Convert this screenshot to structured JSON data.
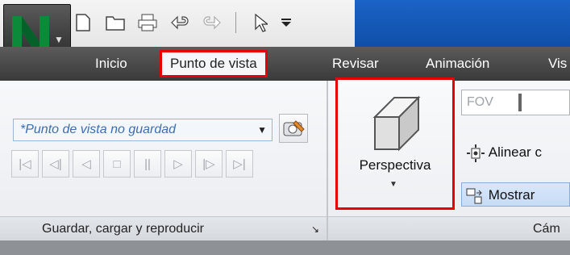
{
  "app": {
    "logo_icon": "navisworks-n-logo",
    "logo_color": "#0b8a3a"
  },
  "quick_access": [
    {
      "icon": "new-file-icon"
    },
    {
      "icon": "open-folder-icon"
    },
    {
      "icon": "print-icon"
    },
    {
      "icon": "undo-icon"
    },
    {
      "icon": "redo-icon"
    },
    {
      "icon": "select-cursor-icon"
    },
    {
      "icon": "customize-dropdown-icon"
    }
  ],
  "tabs": [
    {
      "label": "Inicio"
    },
    {
      "label": "Punto de vista",
      "active": true
    },
    {
      "label": "Revisar"
    },
    {
      "label": "Animación"
    },
    {
      "label": "Vis"
    }
  ],
  "saveload": {
    "viewpoint_value": "*Punto de vista no guardad",
    "panel_label": "Guardar, cargar y reproducir",
    "playback": [
      "first-frame-icon",
      "step-back-icon",
      "play-reverse-icon",
      "stop-icon",
      "pause-icon",
      "play-icon",
      "step-forward-icon",
      "last-frame-icon"
    ]
  },
  "camera": {
    "perspective_label": "Perspectiva",
    "fov_placeholder": "FOV",
    "align_label": "Alinear c",
    "show_label": "Mostrar",
    "panel_label": "Cám"
  },
  "highlight_color": "#e60000"
}
